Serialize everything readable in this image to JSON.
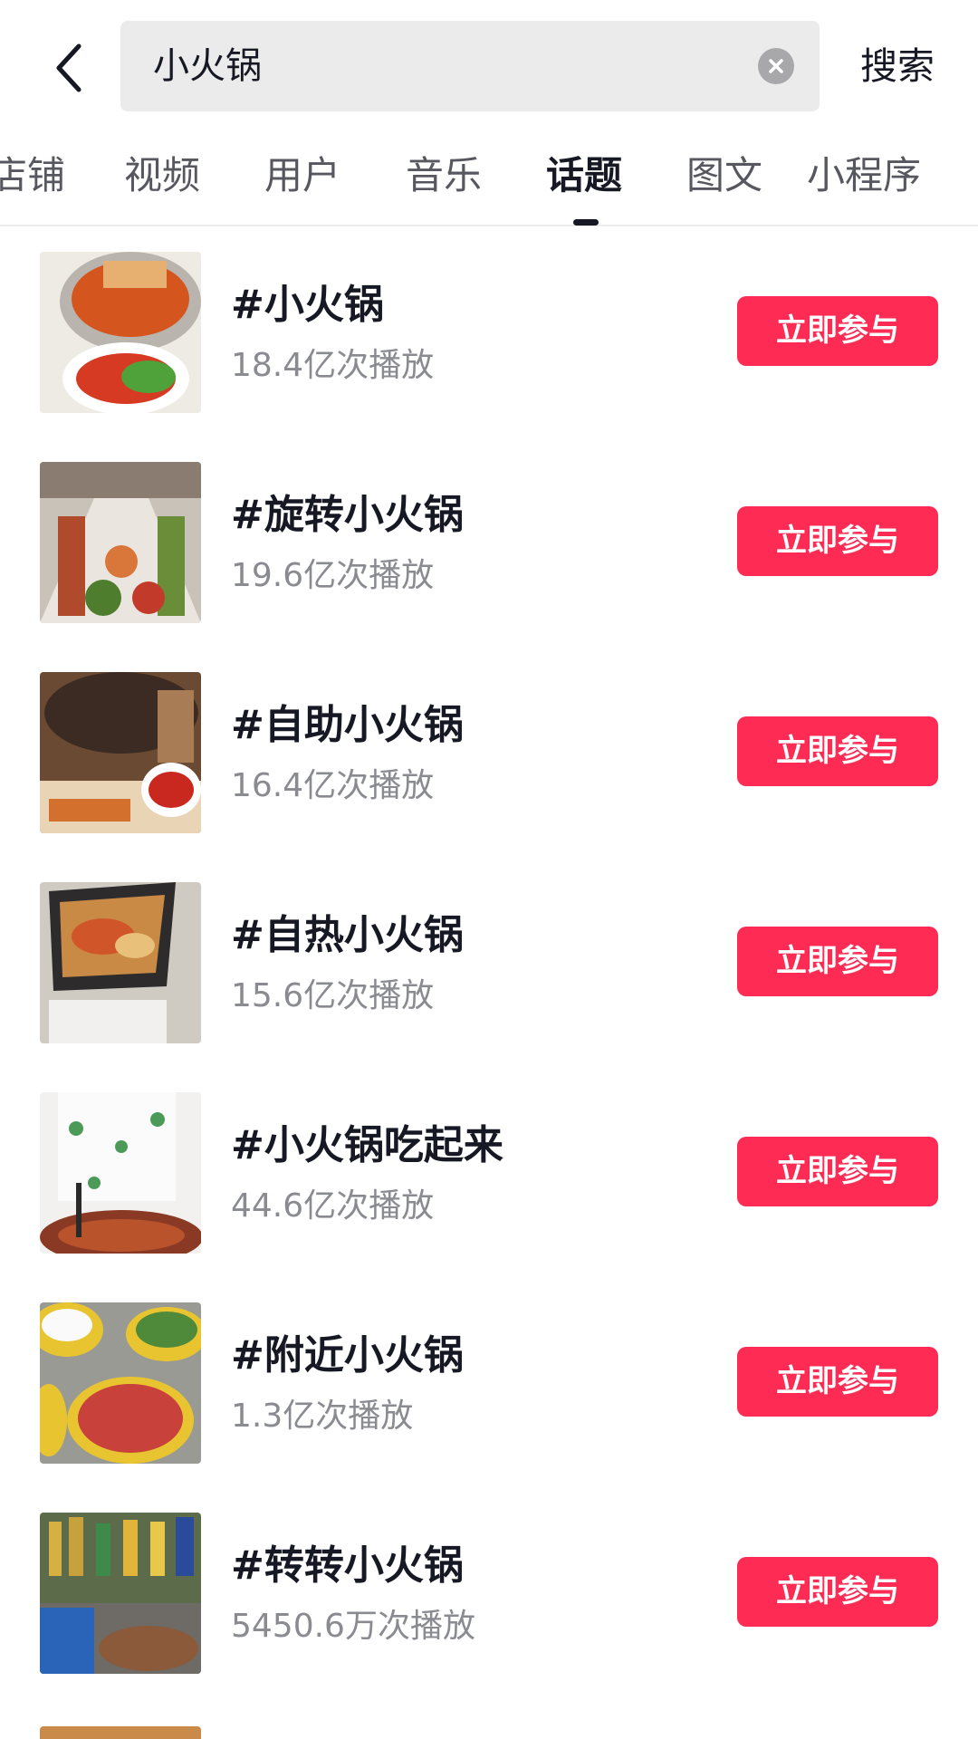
{
  "header": {
    "query": "小火锅",
    "submit_label": "搜索"
  },
  "tabs": [
    {
      "label": "店铺",
      "active": false
    },
    {
      "label": "视频",
      "active": false
    },
    {
      "label": "用户",
      "active": false
    },
    {
      "label": "音乐",
      "active": false
    },
    {
      "label": "话题",
      "active": true
    },
    {
      "label": "图文",
      "active": false
    },
    {
      "label": "小程序",
      "active": false
    }
  ],
  "topics": [
    {
      "title": "#小火锅",
      "plays": "18.4亿次播放",
      "button": "立即参与"
    },
    {
      "title": "#旋转小火锅",
      "plays": "19.6亿次播放",
      "button": "立即参与"
    },
    {
      "title": "#自助小火锅",
      "plays": "16.4亿次播放",
      "button": "立即参与"
    },
    {
      "title": "#自热小火锅",
      "plays": "15.6亿次播放",
      "button": "立即参与"
    },
    {
      "title": "#小火锅吃起来",
      "plays": "44.6亿次播放",
      "button": "立即参与"
    },
    {
      "title": "#附近小火锅",
      "plays": "1.3亿次播放",
      "button": "立即参与"
    },
    {
      "title": "#转转小火锅",
      "plays": "5450.6万次播放",
      "button": "立即参与"
    }
  ],
  "colors": {
    "accent": "#fe2c55",
    "text": "#161823",
    "secondary_text": "#8a8b91",
    "search_bg": "#ebebeb"
  },
  "icons": {
    "back": "chevron-left-icon",
    "clear": "clear-icon"
  }
}
